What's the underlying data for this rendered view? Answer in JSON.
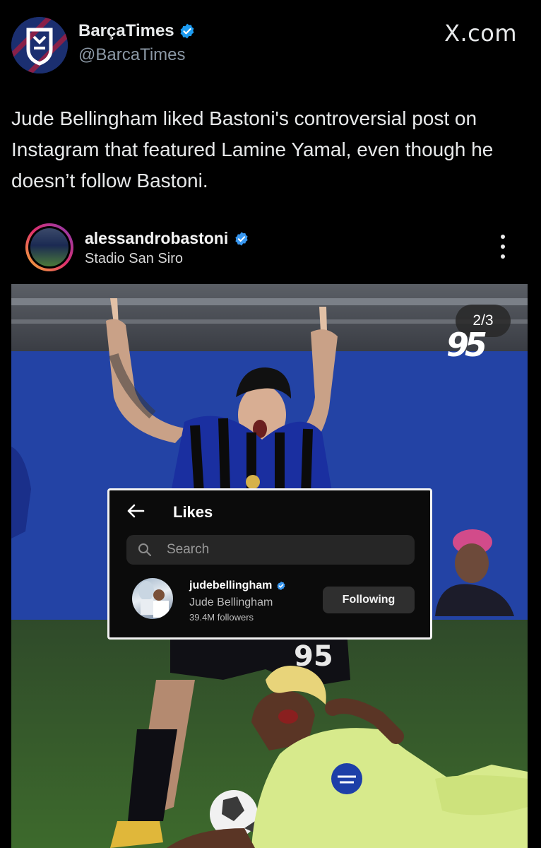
{
  "tweet": {
    "display_name": "BarçaTimes",
    "handle": "@BarcaTimes",
    "brand": "X.com",
    "text": "Jude Bellingham liked Bastoni's controversial post on Instagram that featured Lamine Yamal, even though he doesn’t follow Bastoni.",
    "verified_color": "#1d9bf0"
  },
  "instagram_post": {
    "username": "alessandrobastoni",
    "location": "Stadio San Siro",
    "carousel_counter": "2/3",
    "number_logo": "95",
    "jersey_number": "95"
  },
  "likes_panel": {
    "title": "Likes",
    "search_placeholder": "Search",
    "liker": {
      "username": "judebellingham",
      "full_name": "Jude Bellingham",
      "followers": "39.4M followers",
      "button_label": "Following"
    },
    "highlight_color": "#d8201f"
  }
}
